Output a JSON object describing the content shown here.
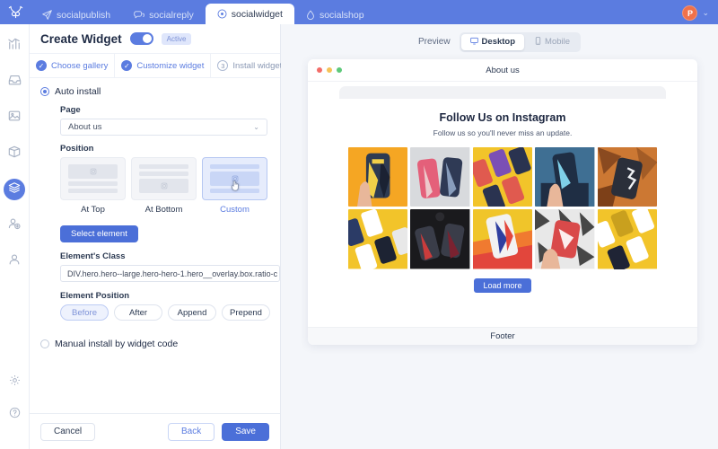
{
  "topnav": {
    "logo_icon": "antler-logo-icon",
    "tabs": [
      {
        "label": "socialpublish",
        "icon": "paper-plane-icon",
        "active": false
      },
      {
        "label": "socialreply",
        "icon": "chat-bubble-icon",
        "active": false
      },
      {
        "label": "socialwidget",
        "icon": "target-circle-icon",
        "active": true
      },
      {
        "label": "socialshop",
        "icon": "tag-drop-icon",
        "active": false
      }
    ],
    "avatar_initial": "P",
    "avatar_color": "#f0714a",
    "caret": "⌄",
    "background_color": "#5b7ce0"
  },
  "rail": {
    "items": [
      {
        "icon": "analytics-chart-icon",
        "active": false
      },
      {
        "icon": "inbox-icon",
        "active": false
      },
      {
        "icon": "image-gallery-icon",
        "active": false
      },
      {
        "icon": "box-cube-icon",
        "active": false
      },
      {
        "icon": "layers-stack-icon",
        "active": true
      },
      {
        "icon": "add-user-icon",
        "active": false
      },
      {
        "icon": "user-profile-icon",
        "active": false
      }
    ],
    "bottom_items": [
      {
        "icon": "gear-settings-icon"
      },
      {
        "icon": "help-question-icon"
      }
    ],
    "active_color": "#5b7ce0"
  },
  "panel": {
    "title": "Create Widget",
    "toggle_on": true,
    "status_badge": "Active",
    "steps": [
      {
        "label": "Choose gallery",
        "state": "done",
        "marker": "✓"
      },
      {
        "label": "Customize widget",
        "state": "done",
        "marker": "✓"
      },
      {
        "label": "Install widget",
        "state": "pending",
        "marker": "3"
      }
    ],
    "install_mode": {
      "auto": {
        "label": "Auto install",
        "selected": true
      },
      "manual": {
        "label": "Manual install by widget code",
        "selected": false
      }
    },
    "page_field": {
      "label": "Page",
      "value": "About us",
      "chevron": "⌄",
      "options": [
        "About us"
      ]
    },
    "position": {
      "label": "Position",
      "cards": [
        {
          "name": "At Top",
          "selected": false,
          "layout": "image-first"
        },
        {
          "name": "At Bottom",
          "selected": false,
          "layout": "image-last"
        },
        {
          "name": "Custom",
          "selected": true,
          "layout": "image-middle",
          "cursor_icon": "pointer-hand-icon"
        }
      ]
    },
    "select_element_button": "Select element",
    "element_class": {
      "label": "Element's Class",
      "value": "DIV.hero.hero--large.hero-hero-1.hero__overlay.box.ratio-c"
    },
    "element_position": {
      "label": "Element Position",
      "chips": [
        {
          "label": "Before",
          "selected": true
        },
        {
          "label": "After",
          "selected": false
        },
        {
          "label": "Append",
          "selected": false
        },
        {
          "label": "Prepend",
          "selected": false
        }
      ]
    },
    "footer": {
      "cancel": "Cancel",
      "back": "Back",
      "save": "Save"
    }
  },
  "preview": {
    "label": "Preview",
    "modes": [
      {
        "label": "Desktop",
        "icon": "monitor-icon",
        "active": true
      },
      {
        "label": "Mobile",
        "icon": "phone-icon",
        "active": false
      }
    ],
    "browser": {
      "title": "About us",
      "dots": [
        "#f36d68",
        "#f6c358",
        "#5ec97a"
      ],
      "widget_title": "Follow Us on Instagram",
      "widget_subtitle": "Follow us so you'll never miss an update.",
      "load_more": "Load more",
      "footer": "Footer",
      "gallery": [
        {
          "alt": "hand-holding-yellow-black-phone-case",
          "bg": "#f5a623",
          "tones": [
            "#2e3b52",
            "#f2d049",
            "#1b2233"
          ]
        },
        {
          "alt": "two-striped-phone-cases-on-grey",
          "bg": "#d8dadd",
          "tones": [
            "#e4607a",
            "#2f3a55",
            "#f0ece7"
          ]
        },
        {
          "alt": "yellow-grid-phone-cases-pattern",
          "bg": "#f2c42a",
          "tones": [
            "#7b4fb5",
            "#e05a4f",
            "#2a3350"
          ]
        },
        {
          "alt": "hand-holding-blue-patterned-case",
          "bg": "#3f6f93",
          "tones": [
            "#1f2e44",
            "#7fd0e8",
            "#e8b79a"
          ]
        },
        {
          "alt": "dark-case-on-orange-leaves",
          "bg": "#cc7833",
          "tones": [
            "#2b2f3a",
            "#f0f2f5",
            "#8a4a20"
          ]
        },
        {
          "alt": "yellow-tray-with-white-cases",
          "bg": "#f2c42a",
          "tones": [
            "#ffffff",
            "#2b3b66",
            "#1d2333"
          ]
        },
        {
          "alt": "dark-moody-red-cases-overhead",
          "bg": "#1a1a1d",
          "tones": [
            "#c93c3c",
            "#7a2230",
            "#3a3d49"
          ]
        },
        {
          "alt": "red-blue-case-on-orange-gradient",
          "bg": "#f0c52a",
          "tones": [
            "#e2463c",
            "#2f3fa0",
            "#f07a30"
          ]
        },
        {
          "alt": "hand-holding-red-geometric-case",
          "bg": "#e8e8e8",
          "tones": [
            "#d94a4a",
            "#2a2a2a",
            "#ffffff"
          ]
        },
        {
          "alt": "yellow-background-patterned-cases",
          "bg": "#f2c42a",
          "tones": [
            "#ffffff",
            "#1f2435",
            "#c9a01e"
          ]
        }
      ]
    }
  }
}
